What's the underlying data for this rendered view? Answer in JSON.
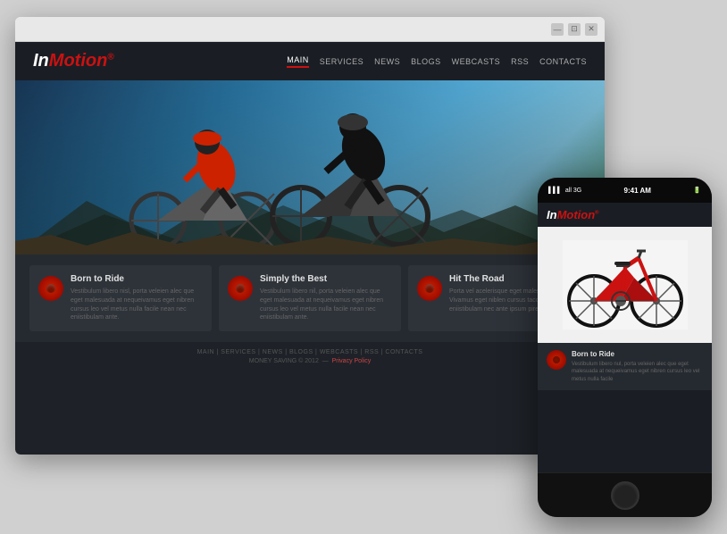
{
  "browser": {
    "buttons": [
      "minimize",
      "maximize",
      "close"
    ],
    "button_icons": [
      "—",
      "⊡",
      "✕"
    ]
  },
  "website": {
    "logo_plain": "In",
    "logo_styled": "Motion",
    "logo_sup": "®",
    "nav": [
      {
        "label": "MAIN",
        "active": true
      },
      {
        "label": "SERVICES",
        "active": false
      },
      {
        "label": "NEWS",
        "active": false
      },
      {
        "label": "BLOGS",
        "active": false
      },
      {
        "label": "WEBCASTS",
        "active": false
      },
      {
        "label": "RSS",
        "active": false
      },
      {
        "label": "CONTACTS",
        "active": false
      }
    ],
    "cards": [
      {
        "title": "Born to Ride",
        "body": "Vestibulum libero nisl, porta veleien alec que eget malesuada at nequeivamus eget nibren cursus leo vel metus nulla facile nean nec eniistibulam ante."
      },
      {
        "title": "Simply the Best",
        "body": "Vestibulum libero nil, porta veleien alec que eget malesuada at nequeivamus eget nibren cursus leo vel metus nulla facile nean nec eniistibulam ante."
      },
      {
        "title": "Hit The Road",
        "body": "Porta vel acelerisque eget malesuada dique. Vivamus eget niblen cursus taccisement nec eniistibulam nec ante ipsum pireio hasedpam."
      }
    ],
    "footer": {
      "nav": "MAIN | SERVICES | NEWS | BLOGS | WEBCASTS | RSS | CONTACTS",
      "copy_text": "MONEY SAVING © 2012",
      "copy_link": "Privacy Policy"
    }
  },
  "phone": {
    "status_left": "all 3G",
    "time": "9:41 AM",
    "status_right": "■ ■ ■",
    "logo_plain": "In",
    "logo_styled": "Motion",
    "logo_sup": "®",
    "card": {
      "title": "Born to Ride",
      "body": "Vestibulum libero nul, porta veleien alec que eget malesuada at nequeivamus eget nibren cursus leo vel metus nulla facile"
    }
  },
  "colors": {
    "accent": "#cc1111",
    "dark_bg": "#1e2228",
    "card_bg": "#2e333a",
    "text_primary": "#e0e0e0",
    "text_muted": "#666666"
  }
}
